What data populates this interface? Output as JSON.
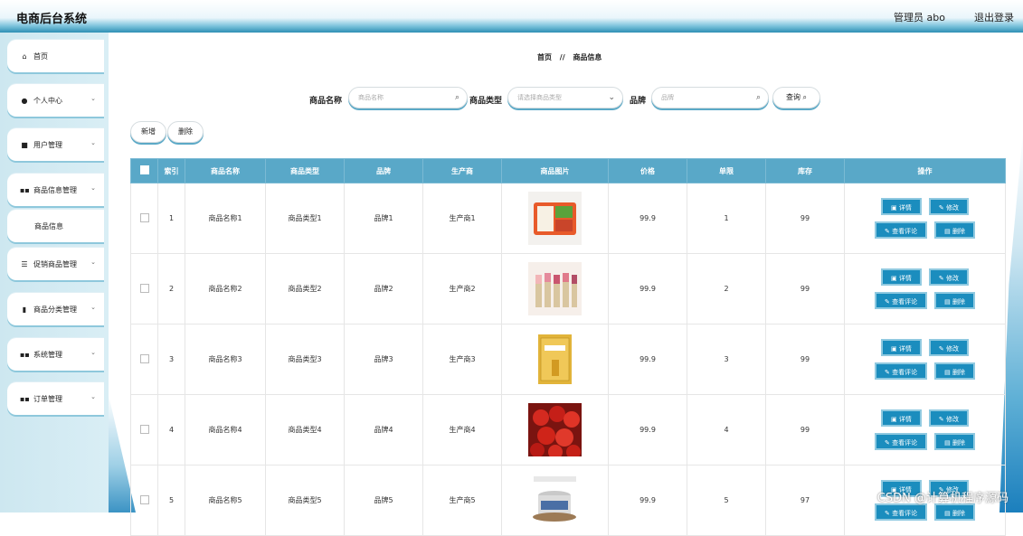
{
  "header": {
    "title": "电商后台系统",
    "user": "管理员 abo",
    "logout": "退出登录"
  },
  "sidebar": {
    "items": [
      {
        "icon": "home-icon",
        "glyph": "⌂",
        "label": "首页",
        "chev": ""
      },
      {
        "icon": "user-icon",
        "glyph": "●",
        "label": "个人中心",
        "chev": "⌄"
      },
      {
        "icon": "users-icon",
        "glyph": "■",
        "label": "用户管理",
        "chev": "⌄"
      },
      {
        "icon": "grid-icon",
        "glyph": "▪▪",
        "label": "商品信息管理",
        "chev": "⌄"
      },
      {
        "icon": "",
        "glyph": "",
        "label": "商品信息",
        "chev": ""
      },
      {
        "icon": "list-icon",
        "glyph": "☰",
        "label": "促销商品管理",
        "chev": "⌄"
      },
      {
        "icon": "category-icon",
        "glyph": "▮",
        "label": "商品分类管理",
        "chev": "⌄"
      },
      {
        "icon": "system-icon",
        "glyph": "▪▪",
        "label": "系统管理",
        "chev": "⌄"
      },
      {
        "icon": "order-icon",
        "glyph": "▪▪",
        "label": "订单管理",
        "chev": "⌄"
      }
    ]
  },
  "breadcrumb": {
    "home": "首页",
    "sep": "//",
    "current": "商品信息"
  },
  "search": {
    "name_label": "商品名称",
    "name_placeholder": "商品名称",
    "type_label": "商品类型",
    "type_placeholder": "请选择商品类型",
    "brand_label": "品牌",
    "brand_placeholder": "品牌",
    "query_label": "查询"
  },
  "actions": {
    "add": "新增",
    "delete": "删除"
  },
  "table": {
    "headers": [
      "索引",
      "商品名称",
      "商品类型",
      "品牌",
      "生产商",
      "商品图片",
      "价格",
      "单限",
      "库存",
      "操作"
    ],
    "rows": [
      {
        "index": "1",
        "name": "商品名称1",
        "type": "商品类型1",
        "brand": "品牌1",
        "maker": "生产商1",
        "price": "99.9",
        "limit": "1",
        "stock": "99"
      },
      {
        "index": "2",
        "name": "商品名称2",
        "type": "商品类型2",
        "brand": "品牌2",
        "maker": "生产商2",
        "price": "99.9",
        "limit": "2",
        "stock": "99"
      },
      {
        "index": "3",
        "name": "商品名称3",
        "type": "商品类型3",
        "brand": "品牌3",
        "maker": "生产商3",
        "price": "99.9",
        "limit": "3",
        "stock": "99"
      },
      {
        "index": "4",
        "name": "商品名称4",
        "type": "商品类型4",
        "brand": "品牌4",
        "maker": "生产商4",
        "price": "99.9",
        "limit": "4",
        "stock": "99"
      },
      {
        "index": "5",
        "name": "商品名称5",
        "type": "商品类型5",
        "brand": "品牌5",
        "maker": "生产商5",
        "price": "99.9",
        "limit": "5",
        "stock": "97"
      }
    ],
    "ops": {
      "detail": "详情",
      "edit": "修改",
      "review": "查看评论",
      "remove": "删除"
    }
  },
  "watermark": "CSDN @计算机程序源码",
  "colors": {
    "header_accent": "#2d8fb4",
    "table_header": "#59a8c8",
    "op_button": "#1b8dbe"
  }
}
